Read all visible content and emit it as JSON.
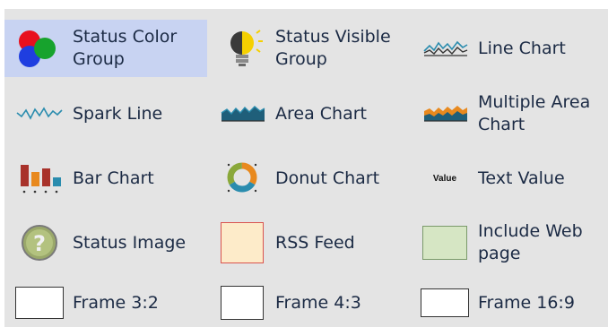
{
  "widgets": [
    {
      "label": "Status Color Group",
      "icon": "status-color-group-icon",
      "selected": true
    },
    {
      "label": "Status Visible Group",
      "icon": "lightbulb-icon"
    },
    {
      "label": "Line Chart",
      "icon": "line-chart-icon"
    },
    {
      "label": "Spark Line",
      "icon": "spark-line-icon"
    },
    {
      "label": "Area Chart",
      "icon": "area-chart-icon"
    },
    {
      "label": "Multiple Area Chart",
      "icon": "multiple-area-chart-icon"
    },
    {
      "label": "Bar Chart",
      "icon": "bar-chart-icon"
    },
    {
      "label": "Donut Chart",
      "icon": "donut-chart-icon"
    },
    {
      "label": "Text Value",
      "icon": "text-value-icon",
      "icon_text": "Value"
    },
    {
      "label": "Status Image",
      "icon": "status-image-question-icon"
    },
    {
      "label": "RSS Feed",
      "icon": "rss-feed-icon"
    },
    {
      "label": "Include Web page",
      "icon": "include-web-page-icon"
    },
    {
      "label": "Frame 3:2",
      "icon": "frame-3-2-icon"
    },
    {
      "label": "Frame 4:3",
      "icon": "frame-4-3-icon"
    },
    {
      "label": "Frame 16:9",
      "icon": "frame-16-9-icon"
    }
  ],
  "colors": {
    "panel": "#e4e4e4",
    "selected": "#c8d3f2",
    "label": "#1b2a44",
    "red": "#e8101e",
    "blue": "#1f3ee0",
    "green": "#17a32d",
    "bulb_yellow": "#f5d000",
    "rss_fill": "#fdebc9",
    "rss_border": "#d9534f",
    "web_fill": "#d6e6c4",
    "web_border": "#7a9a6a"
  }
}
